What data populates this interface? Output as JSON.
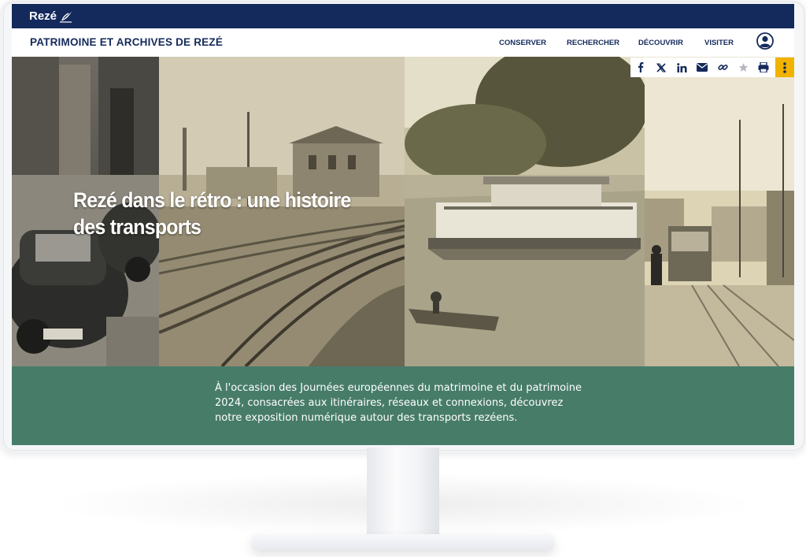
{
  "brand": {
    "logo_text": "Rezé",
    "logo_icon": "leaf-icon",
    "bar_color": "#142a5c"
  },
  "nav": {
    "site_title": "PATRIMOINE ET ARCHIVES DE REZÉ",
    "items": [
      {
        "label": "CONSERVER"
      },
      {
        "label": "RECHERCHER"
      },
      {
        "label": "DÉCOUVRIR"
      },
      {
        "label": "VISITER"
      }
    ],
    "account_icon": "user-account-icon"
  },
  "share_toolbar": {
    "icons": [
      "facebook-icon",
      "x-icon",
      "linkedin-icon",
      "email-icon",
      "link-icon",
      "star-icon",
      "print-icon",
      "more-vertical-icon"
    ],
    "accent": "#f2b200"
  },
  "hero": {
    "title": "Rezé dans le rétro : une histoire des transports",
    "images": [
      "vintage-cars",
      "railway-tracks",
      "paddle-steamer-on-river",
      "tramway-street"
    ]
  },
  "intro": {
    "text": "À l'occasion des Journées européennes du matrimoine et du patrimoine 2024, consacrées aux itinéraires, réseaux et connexions, découvrez notre exposition numérique autour des transports rezéens.",
    "background": "#477c69"
  }
}
